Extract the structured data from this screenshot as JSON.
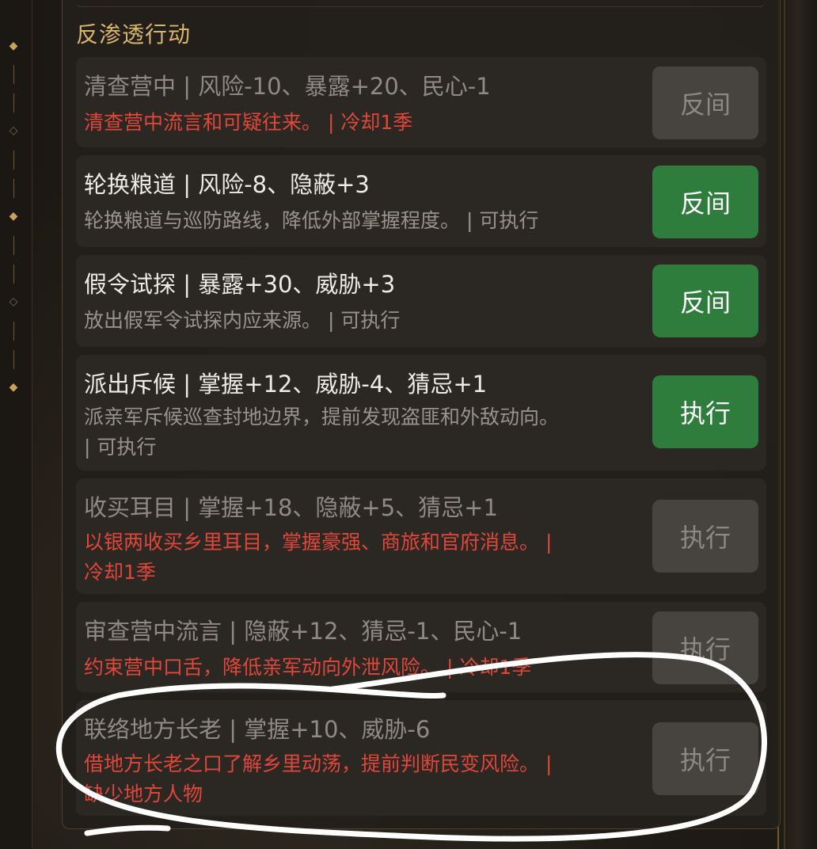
{
  "section_title": "反渗透行动",
  "actions": [
    {
      "title": "清查营中  |  风险-10、暴露+20、民心-1",
      "desc_lines": [
        "清查营中流言和可疑往来。  |  冷却1季"
      ],
      "button": "反间",
      "enabled": false
    },
    {
      "title": "轮换粮道  |  风险-8、隐蔽+3",
      "desc_lines": [
        "轮换粮道与巡防路线，降低外部掌握程度。  |  可执行"
      ],
      "button": "反间",
      "enabled": true
    },
    {
      "title": "假令试探  |  暴露+30、威胁+3",
      "desc_lines": [
        "放出假军令试探内应来源。  |  可执行"
      ],
      "button": "反间",
      "enabled": true
    },
    {
      "title": "派出斥候  |  掌握+12、威胁-4、猜忌+1",
      "desc_lines": [
        "派亲军斥候巡查封地边界，提前发现盗匪和外敌动向。",
        " |  可执行"
      ],
      "button": "执行",
      "enabled": true
    },
    {
      "title": "收买耳目  |  掌握+18、隐蔽+5、猜忌+1",
      "desc_lines": [
        "以银两收买乡里耳目，掌握豪强、商旅和官府消息。  |",
        "冷却1季"
      ],
      "button": "执行",
      "enabled": false
    },
    {
      "title": "审查营中流言  |  隐蔽+12、猜忌-1、民心-1",
      "desc_lines": [
        "约束营中口舌，降低亲军动向外泄风险。  |  冷却1季"
      ],
      "button": "执行",
      "enabled": false
    },
    {
      "title": "联络地方长老  |  掌握+10、威胁-6",
      "desc_lines": [
        "借地方长老之口了解乡里动荡，提前判断民变风险。  |",
        "缺少地方人物"
      ],
      "button": "执行",
      "enabled": false
    }
  ],
  "colors": {
    "accent_gold": "#d9b46b",
    "enabled_button": "#2e7d3c",
    "disabled_button": "#47443f",
    "warning_text": "#e0463a"
  }
}
